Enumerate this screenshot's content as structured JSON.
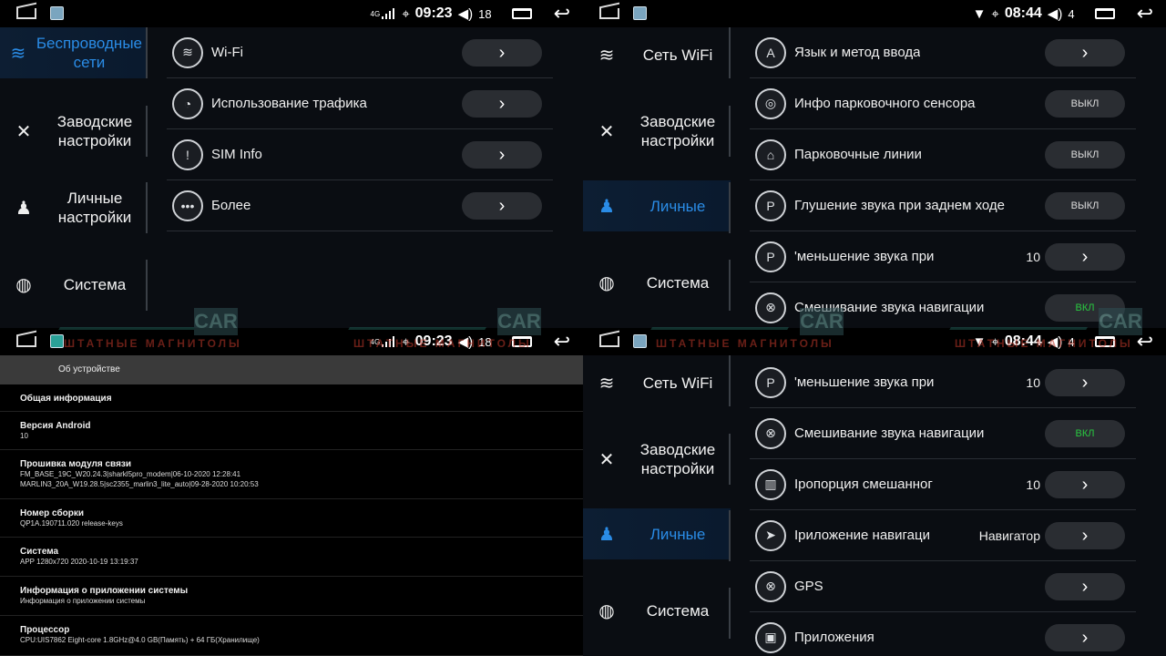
{
  "status_a": {
    "sig_label": "4G",
    "time": "09:23",
    "volume": "18"
  },
  "status_b": {
    "time": "08:44",
    "volume": "4"
  },
  "watermark": {
    "logo": "CAR",
    "text": "ШТАТНЫЕ МАГНИТОЛЫ"
  },
  "q1": {
    "sidebar": [
      {
        "label": "Беспроводные сети",
        "icon": "wifi-icon"
      },
      {
        "label": "Заводские настройки",
        "icon": "wrench-icon"
      },
      {
        "label": "Личные настройки",
        "icon": "person-icon"
      },
      {
        "label": "Система",
        "icon": "globe-icon"
      }
    ],
    "rows": [
      {
        "label": "Wi-Fi",
        "icon": "wifi-icon"
      },
      {
        "label": "Использование трафика",
        "icon": "data-usage-icon"
      },
      {
        "label": "SIM Info",
        "icon": "info-icon"
      },
      {
        "label": "Более",
        "icon": "more-icon"
      }
    ]
  },
  "q2": {
    "sidebar": [
      {
        "label": "Сеть WiFi"
      },
      {
        "label": "Заводские настройки"
      },
      {
        "label": "Личные"
      },
      {
        "label": "Система"
      }
    ],
    "rows": [
      {
        "label": "Язык и метод ввода",
        "value": "",
        "button": ""
      },
      {
        "label": "Инфо парковочного сенсора",
        "value": "",
        "button": "ВЫКЛ"
      },
      {
        "label": "Парковочные линии",
        "value": "",
        "button": "ВЫКЛ"
      },
      {
        "label": "Глушение звука при заднем ходе",
        "value": "",
        "button": "ВЫКЛ"
      },
      {
        "label": "'меньшение звука при",
        "value": "10",
        "button": ""
      },
      {
        "label": "Смешивание звука навигации",
        "value": "",
        "button": "ВКЛ"
      }
    ]
  },
  "q3": {
    "title": "Об устройстве",
    "sections": [
      {
        "title": "Общая информация",
        "lines": []
      },
      {
        "title": "Версия Android",
        "lines": [
          "10"
        ]
      },
      {
        "title": "Прошивка модуля связи",
        "lines": [
          "FM_BASE_19C_W20.24.3|sharkl5pro_modem|06-10-2020 12:28:41",
          "MARLIN3_20A_W19.28.5|sc2355_marlin3_lite_auto|09-28-2020 10:20:53"
        ]
      },
      {
        "title": "Номер сборки",
        "lines": [
          "QP1A.190711.020 release-keys"
        ]
      },
      {
        "title": "Система",
        "lines": [
          "APP 1280x720 2020-10-19 13:19:37"
        ]
      },
      {
        "title": "Информация о приложении системы",
        "lines": [
          "Информация о приложении системы"
        ]
      },
      {
        "title": "Процессор",
        "lines": [
          "CPU:UIS7862 Eight-core 1.8GHz@4.0 GB(Память) + 64 ГБ(Хранилище)"
        ]
      }
    ]
  },
  "q4": {
    "sidebar": [
      {
        "label": "Сеть WiFi"
      },
      {
        "label": "Заводские настройки"
      },
      {
        "label": "Личные"
      },
      {
        "label": "Система"
      }
    ],
    "rows": [
      {
        "label": "'меньшение звука при",
        "value": "10",
        "button": ""
      },
      {
        "label": "Смешивание звука навигации",
        "value": "",
        "button": "ВКЛ"
      },
      {
        "label": "Iропорция смешанног",
        "value": "10",
        "button": ""
      },
      {
        "label": "Iриложение навигаци",
        "value": "Навигатор",
        "button": ""
      },
      {
        "label": "GPS",
        "value": "",
        "button": ""
      },
      {
        "label": "Приложения",
        "value": "",
        "button": ""
      }
    ]
  },
  "icons": {
    "chevron": "›"
  }
}
